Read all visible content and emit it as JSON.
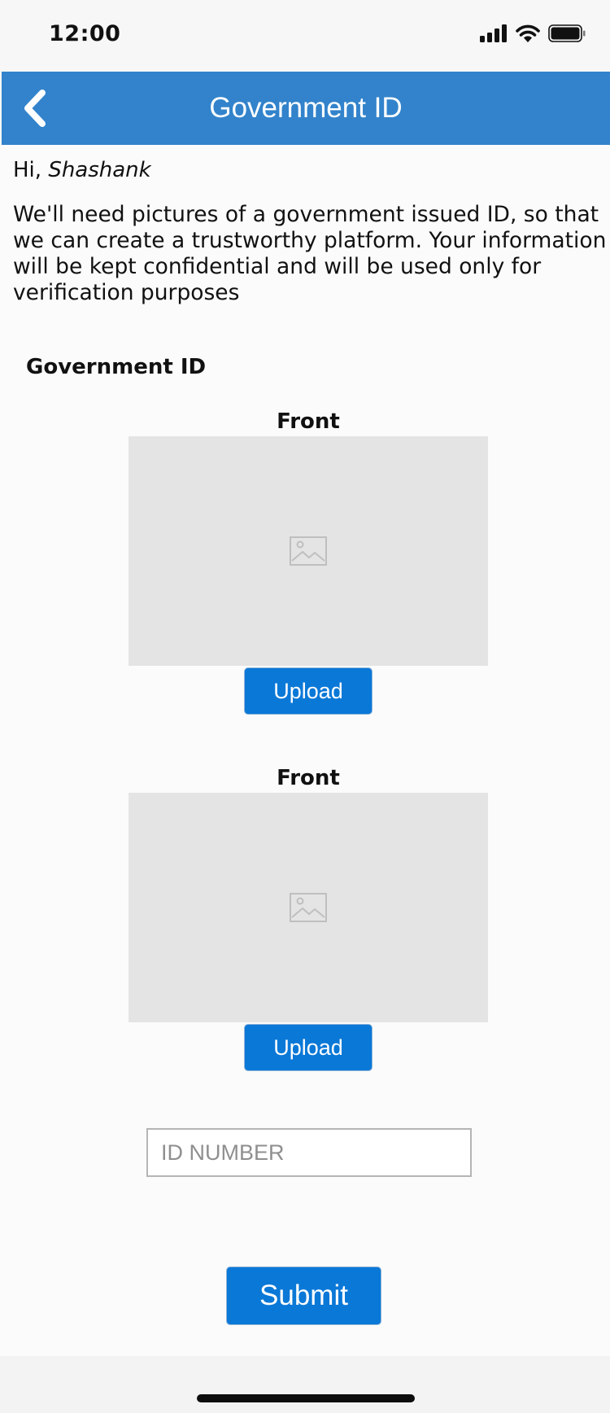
{
  "status_bar": {
    "time": "12:00",
    "icons": [
      "cellular-signal-icon",
      "wifi-icon",
      "battery-icon"
    ]
  },
  "nav": {
    "title": "Government ID",
    "back_icon": "chevron-left-icon",
    "color": "#3283cb"
  },
  "greeting": {
    "prefix": "Hi, ",
    "name": "Shashank"
  },
  "intro_text": "We'll need pictures of a government issued ID, so that we can create a trustworthy platform. Your information will be kept confidential and will be used only for verification purposes",
  "section_heading": "Government ID",
  "id_sides": [
    {
      "label": "Front",
      "placeholder_icon": "image-placeholder-icon",
      "upload_label": "Upload"
    },
    {
      "label": "Front",
      "placeholder_icon": "image-placeholder-icon",
      "upload_label": "Upload"
    }
  ],
  "id_number": {
    "placeholder": "ID NUMBER",
    "value": ""
  },
  "submit_label": "Submit",
  "colors": {
    "primary_button": "#0a78d7",
    "placeholder_box": "#e4e4e4"
  }
}
